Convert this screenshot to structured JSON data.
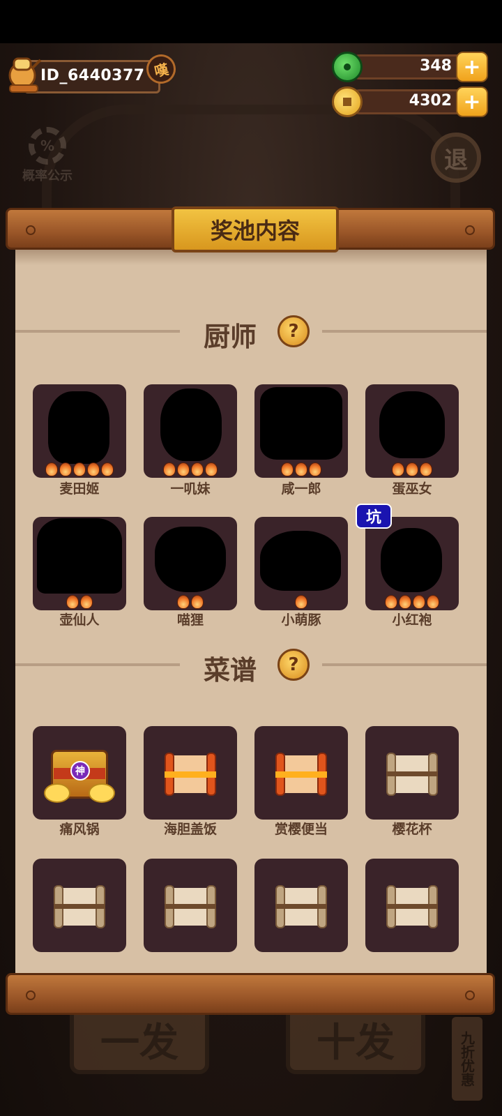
{
  "player": {
    "id": "ID_6440377",
    "badge": "嘆"
  },
  "currencies": [
    {
      "name": "jade",
      "value": "348"
    },
    {
      "name": "coin",
      "value": "4302"
    }
  ],
  "plus_label": "+",
  "probability": {
    "symbol": "%",
    "label": "概率公示"
  },
  "exit_label": "退",
  "panel": {
    "title": "奖池内容"
  },
  "chef_section": {
    "title": "厨师",
    "help": "?",
    "items": [
      {
        "name": "麦田姬",
        "stars": 5
      },
      {
        "name": "一叽妹",
        "stars": 4
      },
      {
        "name": "咸一郎",
        "stars": 3
      },
      {
        "name": "蛋巫女",
        "stars": 3
      },
      {
        "name": "壶仙人",
        "stars": 2
      },
      {
        "name": "喵狸",
        "stars": 2
      },
      {
        "name": "小萌豚",
        "stars": 1
      },
      {
        "name": "小红袍",
        "stars": 4,
        "badge": "坑"
      }
    ]
  },
  "recipe_section": {
    "title": "菜谱",
    "help": "?",
    "items": [
      {
        "name": "痛风锅",
        "kind": "divine",
        "tag": "神"
      },
      {
        "name": "海胆盖饭",
        "kind": "red-scroll"
      },
      {
        "name": "赏樱便当",
        "kind": "red-scroll"
      },
      {
        "name": "樱花杯",
        "kind": "plain-scroll"
      },
      {
        "name": "",
        "kind": "plain-scroll"
      },
      {
        "name": "",
        "kind": "plain-scroll"
      },
      {
        "name": "",
        "kind": "plain-scroll"
      },
      {
        "name": "",
        "kind": "plain-scroll"
      }
    ]
  },
  "bottom": {
    "single_draw": "一发",
    "ten_draw": "十发",
    "discount": "九折优惠"
  },
  "colors": {
    "panel_bg": "#d7c0a5",
    "card_bg": "#3a2329",
    "title_gold": "#f2c342",
    "pit_badge": "#1a14b0"
  }
}
